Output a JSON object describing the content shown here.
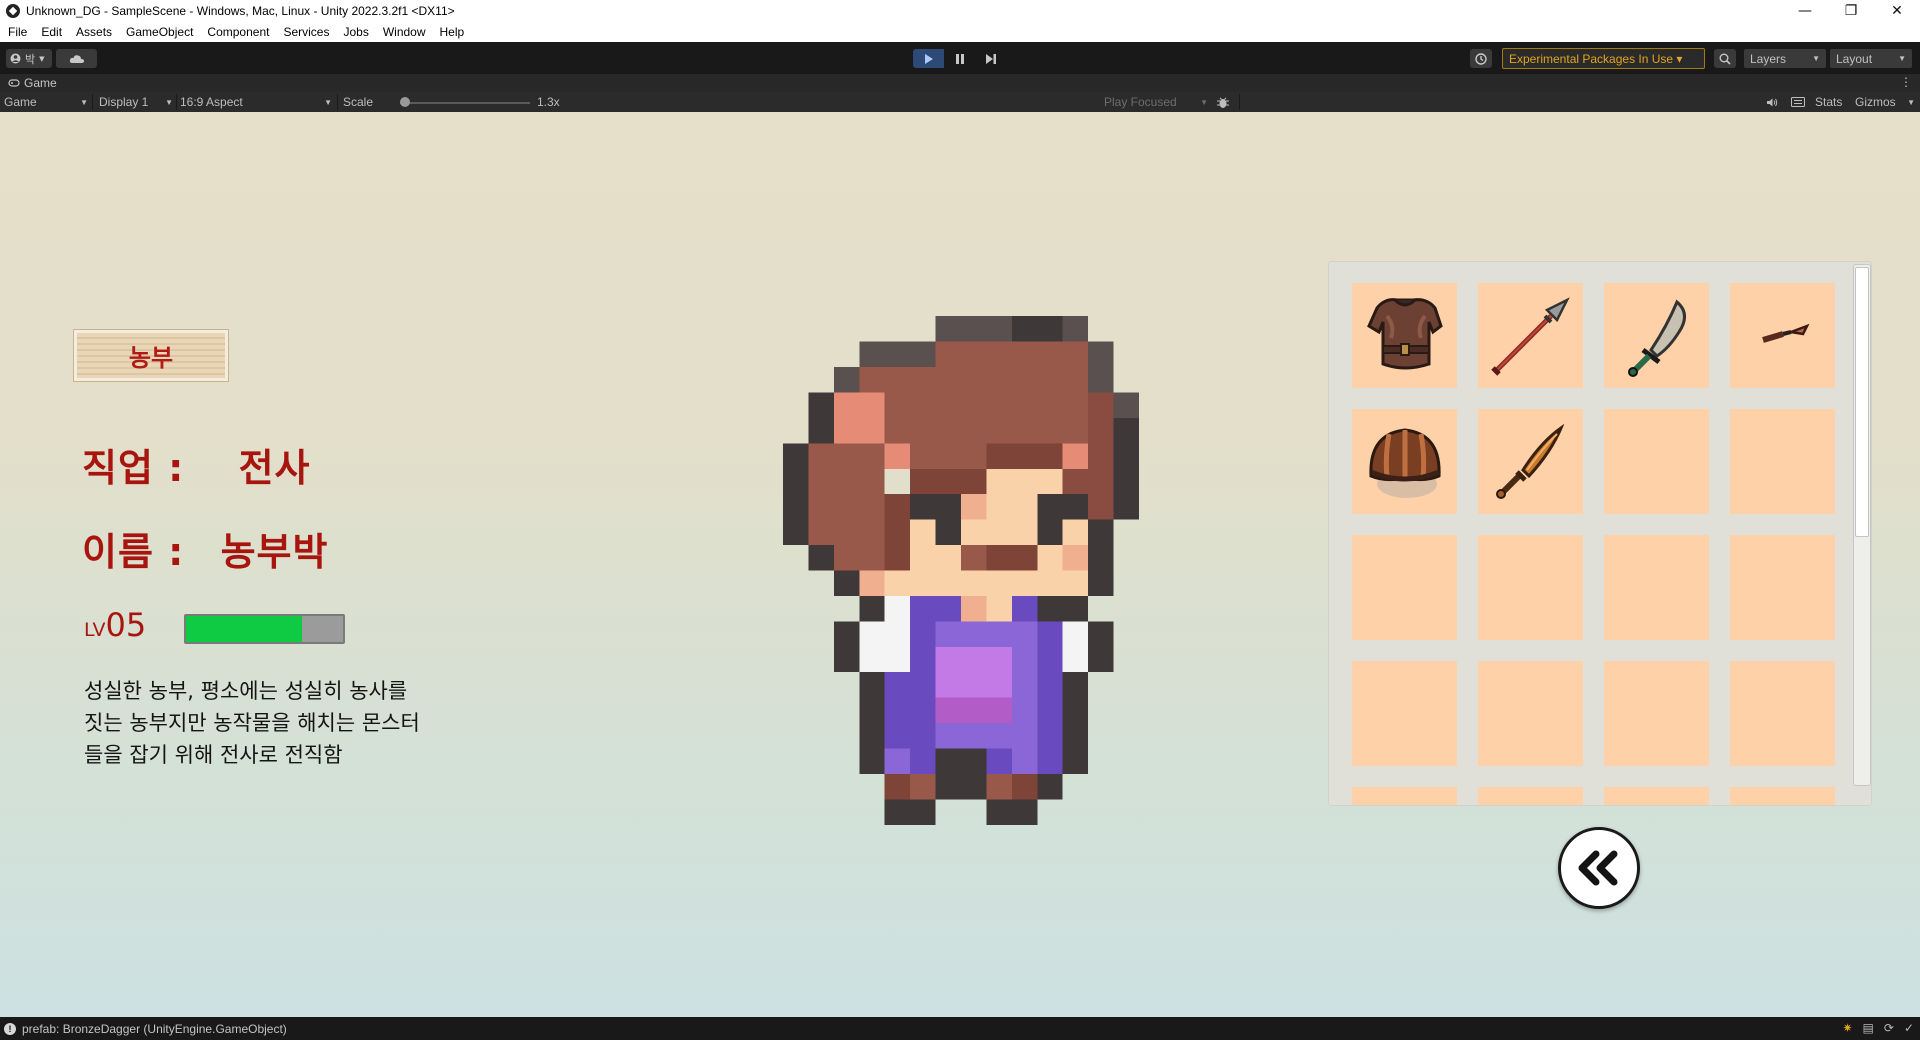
{
  "window": {
    "title": "Unknown_DG - SampleScene - Windows, Mac, Linux - Unity 2022.3.2f1 <DX11>",
    "controls": {
      "minimize": "—",
      "restore": "❐",
      "close": "✕"
    }
  },
  "menu": [
    "File",
    "Edit",
    "Assets",
    "GameObject",
    "Component",
    "Services",
    "Jobs",
    "Window",
    "Help"
  ],
  "toolbar": {
    "account_label": "박",
    "experimental_label": "Experimental Packages In Use ▾",
    "layers_label": "Layers",
    "layout_label": "Layout",
    "accent_color": "#e2a51f"
  },
  "game_tab": {
    "tab_label": "Game",
    "view_dropdown": "Game",
    "display_dropdown": "Display 1",
    "aspect_dropdown": "16:9 Aspect",
    "scale_label": "Scale",
    "scale_value": "1.3x",
    "play_focused": "Play Focused",
    "stats_label": "Stats",
    "gizmos_label": "Gizmos"
  },
  "game": {
    "name_plate": "농부",
    "job_label": "직업 :",
    "job_value": "전사",
    "name_label": "이름 :",
    "name_value": "농부박",
    "level_prefix": "LV",
    "level_value": "05",
    "exp_fraction": 0.74,
    "exp_color": "#0fcb43",
    "description_lines": [
      "성실한 농부, 평소에는 성실히 농사를",
      "짓는 농부지만 농작물을 해치는 몬스터",
      "들을 잡기 위해 전사로 전직함"
    ],
    "inventory": [
      {
        "item": "leather-armor-icon"
      },
      {
        "item": "spear-icon"
      },
      {
        "item": "scimitar-icon"
      },
      {
        "item": "dagger-icon"
      },
      {
        "item": "leather-helmet-icon"
      },
      {
        "item": "bronze-dagger-icon"
      },
      {
        "item": ""
      },
      {
        "item": ""
      },
      {
        "item": ""
      },
      {
        "item": ""
      },
      {
        "item": ""
      },
      {
        "item": ""
      },
      {
        "item": ""
      },
      {
        "item": ""
      },
      {
        "item": ""
      },
      {
        "item": ""
      },
      {
        "item": ""
      },
      {
        "item": ""
      },
      {
        "item": ""
      },
      {
        "item": ""
      }
    ],
    "back_button_icon": "double-chevron-left-icon"
  },
  "status": {
    "message": "prefab: BronzeDagger (UnityEngine.GameObject)"
  }
}
